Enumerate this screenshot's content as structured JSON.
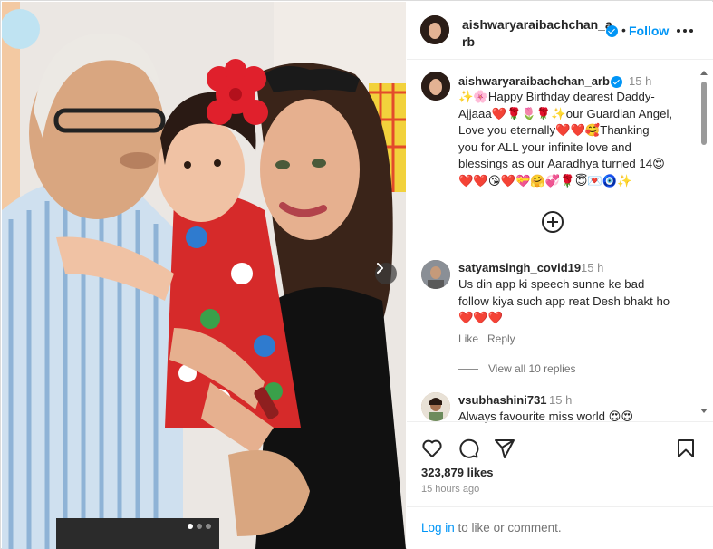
{
  "post": {
    "username": "aishwaryaraibachchan_arb",
    "header_username_line1": "aishwaryaraibachchan_a",
    "header_username_line2": "rb",
    "follow_label": "Follow",
    "separator": "•"
  },
  "caption": {
    "username": "aishwaryaraibachchan_arb",
    "time": "15 h",
    "text": "✨🌸Happy Birthday dearest Daddy-\nAjjaaa❤️🌹🌷🌹✨our Guardian Angel,\nLove you eternally❤️❤️🥰Thanking\nyou for ALL your infinite love and\nblessings as our Aaradhya turned 14😍\n❤️❤️😘❤️💝🤗💞🌹😇💌🧿✨"
  },
  "comments": [
    {
      "username": "satyamsingh_covid19",
      "time": "15 h",
      "text": "Us din app ki speech sunne ke bad\nfollow kiya such app reat Desh bhakt ho\n❤️❤️❤️",
      "like_label": "Like",
      "reply_label": "Reply",
      "view_replies": "View all 10 replies"
    },
    {
      "username": "vsubhashini731",
      "time": "15 h",
      "text": "Always favourite miss world 😍😍"
    }
  ],
  "stats": {
    "likes": "323,879 likes",
    "time_ago": "15 hours ago"
  },
  "login": {
    "link": "Log in",
    "text": " to like or comment."
  },
  "icons": {
    "next": "chevron-right-icon",
    "verified": "verified-badge-icon",
    "more": "more-options-icon",
    "add_comment": "plus-circle-icon",
    "like": "heart-icon",
    "comment": "comment-icon",
    "share": "share-icon",
    "save": "bookmark-icon"
  },
  "colors": {
    "accent": "#0095f6",
    "text": "#262626",
    "muted": "#8e8e8e"
  }
}
